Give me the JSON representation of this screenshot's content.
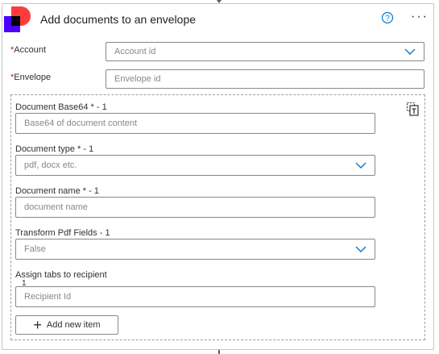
{
  "header": {
    "title": "Add documents to an envelope",
    "help_icon": "help-circle-icon",
    "more_icon": "ellipsis-icon",
    "more_glyph": "···"
  },
  "fields": {
    "account": {
      "required_mark": "*",
      "label": "Account",
      "placeholder": "Account id"
    },
    "envelope": {
      "required_mark": "*",
      "label": "Envelope",
      "placeholder": "Envelope id"
    }
  },
  "document_item": {
    "base64": {
      "label": "Document Base64 * - 1",
      "placeholder": "Base64 of document content"
    },
    "type": {
      "label": "Document type * - 1",
      "placeholder": "pdf, docx etc."
    },
    "name": {
      "label": "Document name * - 1",
      "placeholder": "document name"
    },
    "transform": {
      "label": "Transform Pdf Fields - 1",
      "value": "False"
    },
    "assign_tabs": {
      "label": "Assign tabs to recipient",
      "index": "1",
      "placeholder": "Recipient Id"
    }
  },
  "add_item": {
    "plus": "+",
    "label": "Add new item"
  },
  "colors": {
    "accent": "#0078d4",
    "logo_red": "#ff3c3c",
    "logo_purple": "#4c00ff",
    "required": "#a4262c"
  }
}
